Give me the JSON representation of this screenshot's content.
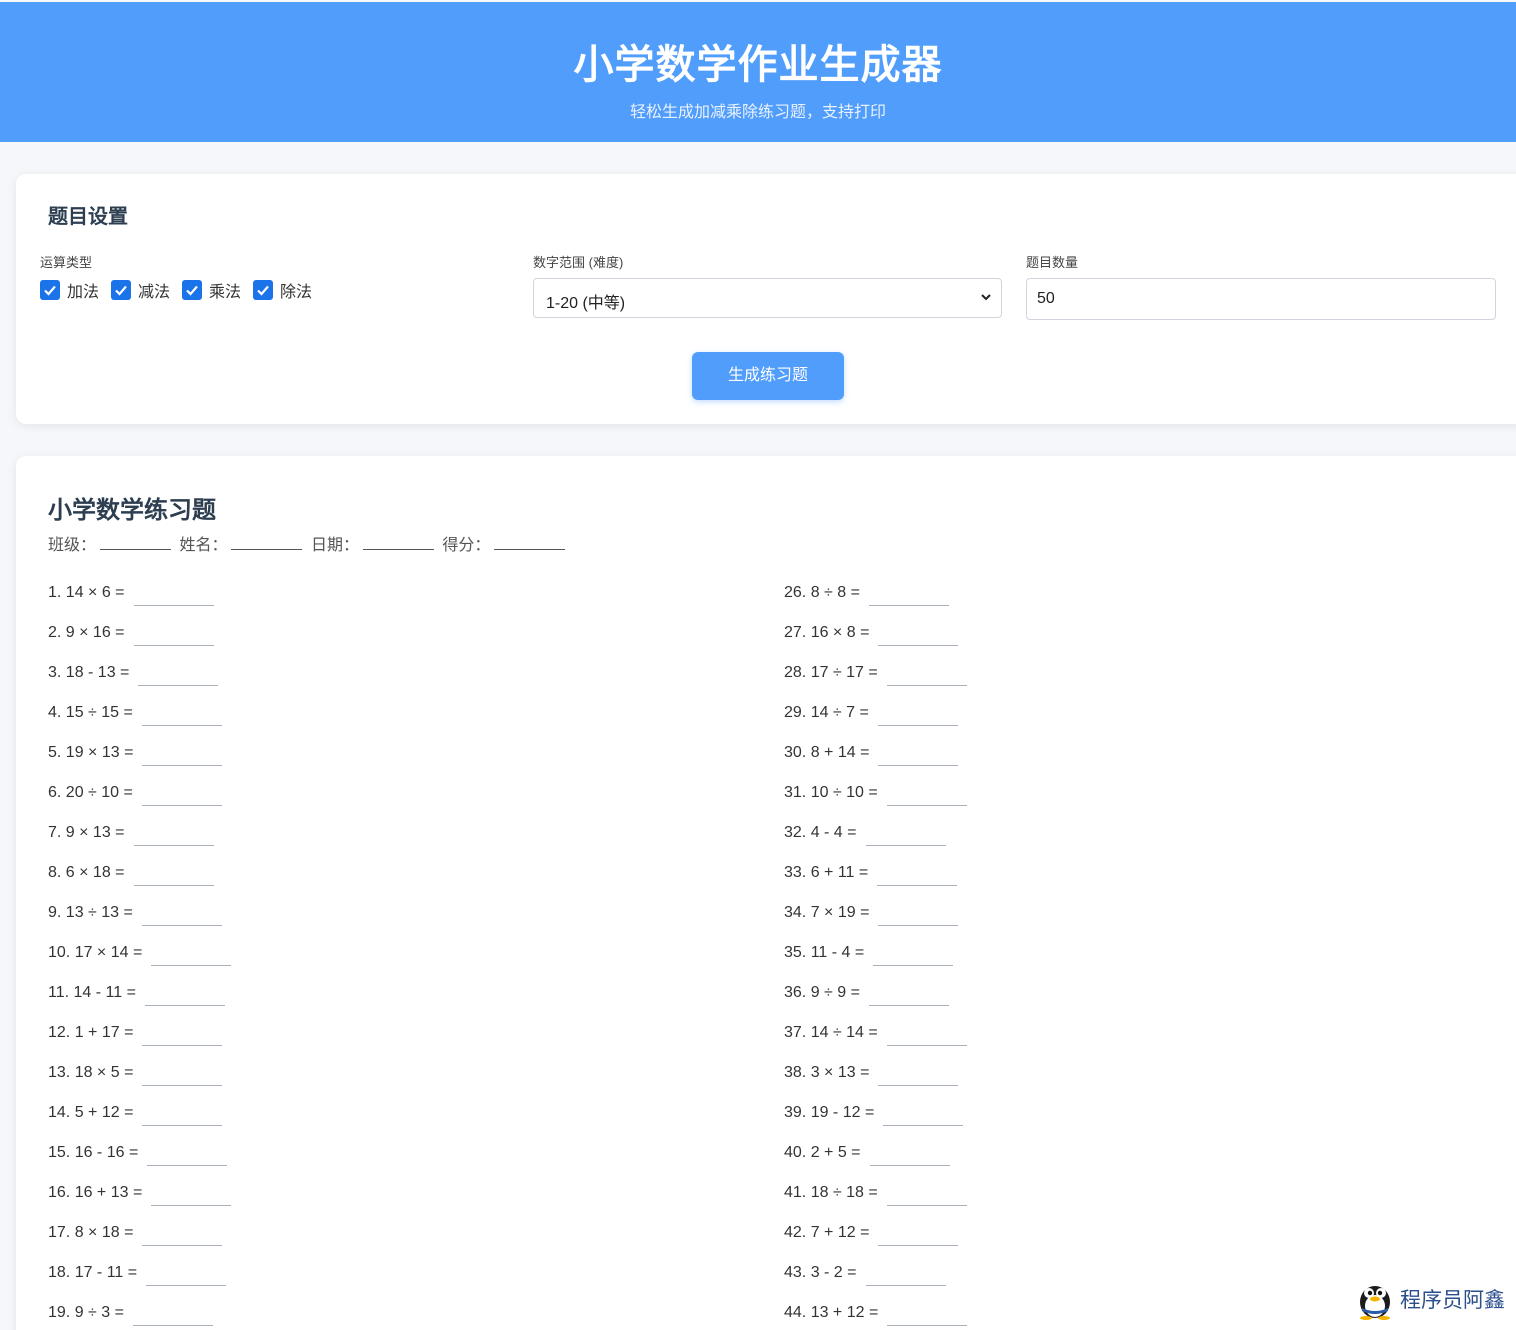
{
  "header": {
    "title": "小学数学作业生成器",
    "subtitle": "轻松生成加减乘除练习题，支持打印"
  },
  "settings": {
    "title": "题目设置",
    "operation_label": "运算类型",
    "operations": [
      {
        "label": "加法",
        "checked": true
      },
      {
        "label": "减法",
        "checked": true
      },
      {
        "label": "乘法",
        "checked": true
      },
      {
        "label": "除法",
        "checked": true
      }
    ],
    "range_label": "数字范围 (难度)",
    "range_value": "1-20 (中等)",
    "count_label": "题目数量",
    "count_value": "50",
    "generate_button": "生成练习题"
  },
  "sheet": {
    "title": "小学数学练习题",
    "fields": [
      "班级：",
      "姓名：",
      "日期：",
      "得分："
    ],
    "problems_left": [
      "1. 14 × 6 =",
      "2. 9 × 16 =",
      "3. 18 - 13 =",
      "4. 15 ÷ 15 =",
      "5. 19 × 13 =",
      "6. 20 ÷ 10 =",
      "7. 9 × 13 =",
      "8. 6 × 18 =",
      "9. 13 ÷ 13 =",
      "10. 17 × 14 =",
      "11. 14 - 11 =",
      "12. 1 + 17 =",
      "13. 18 × 5 =",
      "14. 5 + 12 =",
      "15. 16 - 16 =",
      "16. 16 + 13 =",
      "17. 8 × 18 =",
      "18. 17 - 11 =",
      "19. 9 ÷ 3 ="
    ],
    "problems_right": [
      "26. 8 ÷ 8 =",
      "27. 16 × 8 =",
      "28. 17 ÷ 17 =",
      "29. 14 ÷ 7 =",
      "30. 8 + 14 =",
      "31. 10 ÷ 10 =",
      "32. 4 - 4 =",
      "33. 6 + 11 =",
      "34. 7 × 19 =",
      "35. 11 - 4 =",
      "36. 9 ÷ 9 =",
      "37. 14 ÷ 14 =",
      "38. 3 × 13 =",
      "39. 19 - 12 =",
      "40. 2 + 5 =",
      "41. 18 ÷ 18 =",
      "42. 7 + 12 =",
      "43. 3 - 2 =",
      "44. 13 + 12 ="
    ]
  },
  "watermark": {
    "text": "程序员阿鑫",
    "icon": "qq-penguin-icon"
  },
  "colors": {
    "brand": "#519dfc",
    "checkbox": "#1a73e8",
    "background": "#f5f7fa"
  }
}
